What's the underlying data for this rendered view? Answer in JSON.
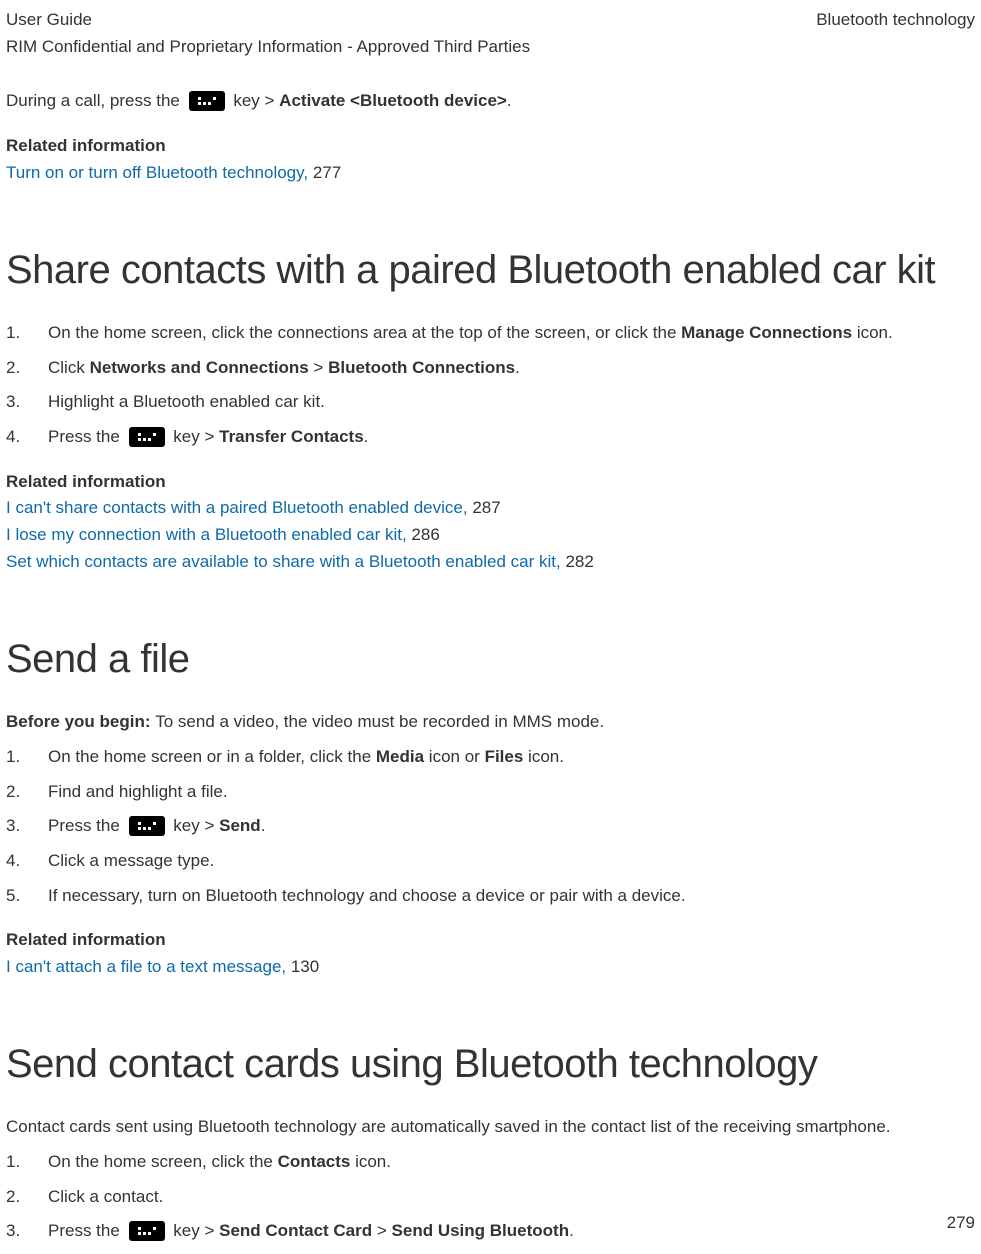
{
  "header": {
    "left1": "User Guide",
    "left2": "RIM Confidential and Proprietary Information - Approved Third Parties",
    "right": "Bluetooth technology"
  },
  "icon": {
    "bb_key": "blackberry-menu-key"
  },
  "intro": {
    "pre": "During a call, press the ",
    "post_a": " key > ",
    "bold1": "Activate <Bluetooth device>",
    "end": "."
  },
  "rel1": {
    "head": "Related information",
    "link1_text": "Turn on or turn off Bluetooth technology, ",
    "link1_page": "277"
  },
  "sec1": {
    "title": "Share contacts with a paired Bluetooth enabled car kit",
    "s1_a": "On the home screen, click the connections area at the top of the screen, or click the ",
    "s1_b": "Manage Connections",
    "s1_c": " icon.",
    "s2_a": "Click ",
    "s2_b": "Networks and Connections",
    "s2_c": " > ",
    "s2_d": "Bluetooth Connections",
    "s2_e": ".",
    "s3": "Highlight a Bluetooth enabled car kit.",
    "s4_a": "Press the ",
    "s4_b": " key > ",
    "s4_c": "Transfer Contacts",
    "s4_d": ".",
    "rel_head": "Related information",
    "l1_t": "I can't share contacts with a paired Bluetooth enabled device, ",
    "l1_p": "287",
    "l2_t": "I lose my connection with a Bluetooth enabled car kit, ",
    "l2_p": "286",
    "l3_t": "Set which contacts are available to share with a Bluetooth enabled car kit, ",
    "l3_p": "282"
  },
  "sec2": {
    "title": "Send a file",
    "byb_bold": "Before you begin: ",
    "byb_text": "To send a video, the video must be recorded in MMS mode.",
    "s1_a": "On the home screen or in a folder, click the ",
    "s1_b": "Media",
    "s1_c": " icon or ",
    "s1_d": "Files",
    "s1_e": " icon.",
    "s2": "Find and highlight a file.",
    "s3_a": "Press the ",
    "s3_b": " key > ",
    "s3_c": "Send",
    "s3_d": ".",
    "s4": "Click a message type.",
    "s5": "If necessary, turn on Bluetooth technology and choose a device or pair with a device.",
    "rel_head": "Related information",
    "l1_t": "I can't attach a file to a text message, ",
    "l1_p": "130"
  },
  "sec3": {
    "title": "Send contact cards using Bluetooth technology",
    "intro": "Contact cards sent using Bluetooth technology are automatically saved in the contact list of the receiving smartphone.",
    "s1_a": "On the home screen, click the ",
    "s1_b": "Contacts",
    "s1_c": " icon.",
    "s2": "Click a contact.",
    "s3_a": "Press the ",
    "s3_b": " key > ",
    "s3_c": "Send Contact Card",
    "s3_d": " > ",
    "s3_e": "Send Using Bluetooth",
    "s3_f": "."
  },
  "page_number": "279"
}
